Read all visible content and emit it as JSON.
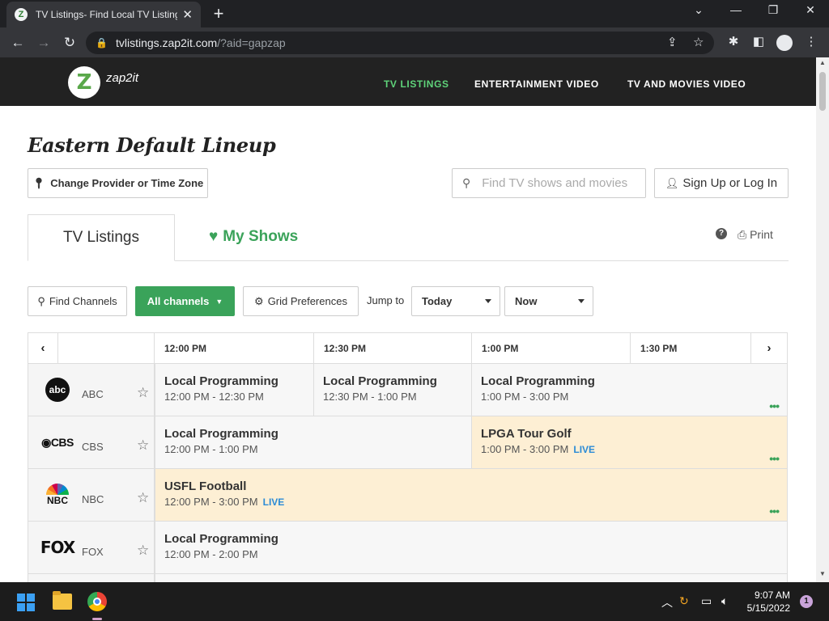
{
  "browser": {
    "tab_title": "TV Listings- Find Local TV Listings",
    "tab_favicon": "Z",
    "url_host": "tvlistings.zap2it.com",
    "url_path": "/?aid=gapzap"
  },
  "site": {
    "logo_text": "zap2it",
    "logo_letter": "Z",
    "nav": [
      "TV LISTINGS",
      "ENTERTAINMENT VIDEO",
      "TV AND MOVIES VIDEO"
    ]
  },
  "page": {
    "title": "Eastern Default Lineup",
    "change_provider": "Change Provider or Time Zone",
    "search_placeholder": "Find TV shows and movies",
    "signup": "Sign Up or Log In",
    "tab_listings": "TV Listings",
    "tab_myshows": "My Shows",
    "print": "Print",
    "find_channels": "Find Channels",
    "all_channels": "All channels",
    "grid_prefs": "Grid Preferences",
    "jump_to": "Jump to",
    "day_select": "Today",
    "time_select": "Now"
  },
  "grid": {
    "times": [
      "12:00 PM",
      "12:30 PM",
      "1:00 PM",
      "1:30 PM"
    ],
    "channels": [
      {
        "name": "ABC",
        "logo": "abc",
        "programs": [
          {
            "title": "Local Programming",
            "time": "12:00 PM - 12:30 PM",
            "live": ""
          },
          {
            "title": "Local Programming",
            "time": "12:30 PM - 1:00 PM",
            "live": ""
          },
          {
            "title": "Local Programming",
            "time": "1:00 PM - 3:00 PM",
            "live": ""
          }
        ]
      },
      {
        "name": "CBS",
        "logo": "◉CBS",
        "programs": [
          {
            "title": "Local Programming",
            "time": "12:00 PM - 1:00 PM",
            "live": ""
          },
          {
            "title": "LPGA Tour Golf",
            "time": "1:00 PM - 3:00 PM",
            "live": "LIVE"
          }
        ]
      },
      {
        "name": "NBC",
        "logo": "NBC",
        "programs": [
          {
            "title": "USFL Football",
            "time": "12:00 PM - 3:00 PM",
            "live": "LIVE"
          }
        ]
      },
      {
        "name": "FOX",
        "logo": "FOX",
        "programs": [
          {
            "title": "Local Programming",
            "time": "12:00 PM - 2:00 PM",
            "live": ""
          }
        ]
      }
    ],
    "more_dots": "•••"
  },
  "taskbar": {
    "time": "9:07 AM",
    "date": "5/15/2022",
    "notifications": "1"
  },
  "colors": {
    "accent_green": "#3aa35a",
    "live_blue": "#2b8bd6",
    "highlight": "#fdefd4",
    "header_dark": "#222222"
  }
}
